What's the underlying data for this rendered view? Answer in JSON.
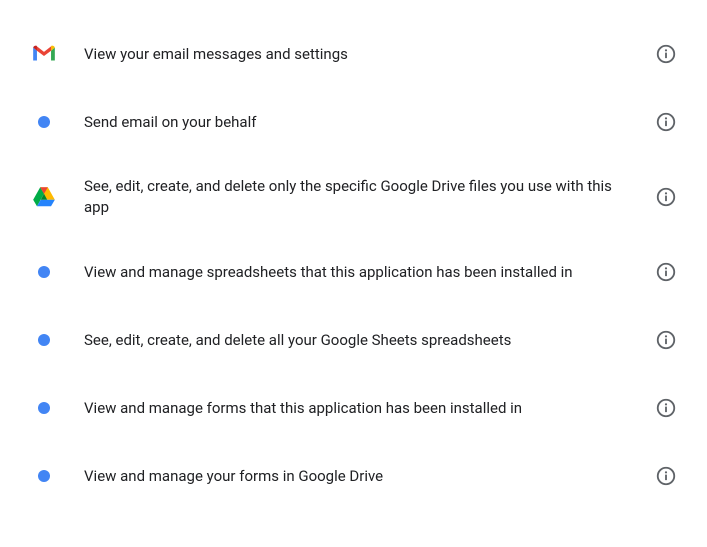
{
  "permissions": [
    {
      "icon": "gmail",
      "text": "View your email messages and settings"
    },
    {
      "icon": "bullet",
      "text": "Send email on your behalf"
    },
    {
      "icon": "drive",
      "text": "See, edit, create, and delete only the specific Google Drive files you use with this app"
    },
    {
      "icon": "bullet",
      "text": "View and manage spreadsheets that this application has been installed in"
    },
    {
      "icon": "bullet",
      "text": "See, edit, create, and delete all your Google Sheets spreadsheets"
    },
    {
      "icon": "bullet",
      "text": "View and manage forms that this application has been installed in"
    },
    {
      "icon": "bullet",
      "text": "View and manage your forms in Google Drive"
    }
  ]
}
